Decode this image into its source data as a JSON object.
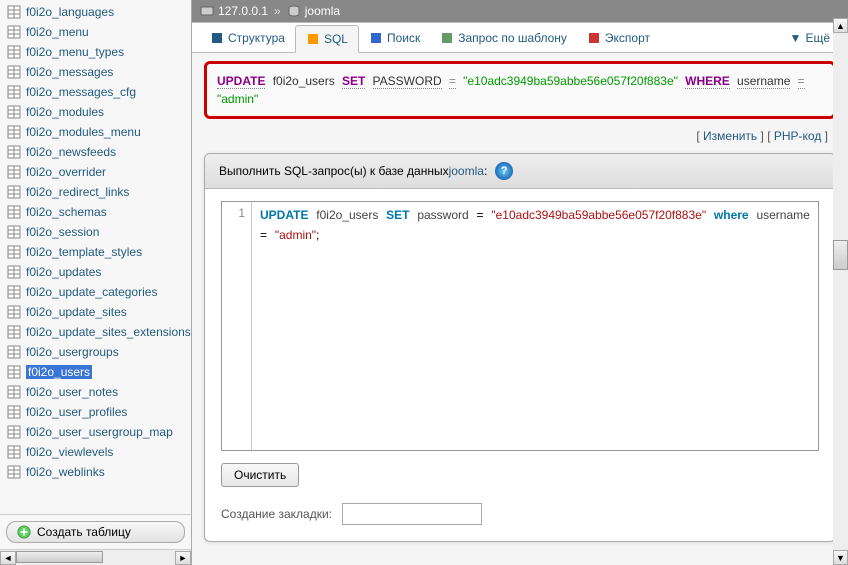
{
  "sidebar": {
    "tables": [
      "f0i2o_languages",
      "f0i2o_menu",
      "f0i2o_menu_types",
      "f0i2o_messages",
      "f0i2o_messages_cfg",
      "f0i2o_modules",
      "f0i2o_modules_menu",
      "f0i2o_newsfeeds",
      "f0i2o_overrider",
      "f0i2o_redirect_links",
      "f0i2o_schemas",
      "f0i2o_session",
      "f0i2o_template_styles",
      "f0i2o_updates",
      "f0i2o_update_categories",
      "f0i2o_update_sites",
      "f0i2o_update_sites_extensions",
      "f0i2o_usergroups",
      "f0i2o_users",
      "f0i2o_user_notes",
      "f0i2o_user_profiles",
      "f0i2o_user_usergroup_map",
      "f0i2o_viewlevels",
      "f0i2o_weblinks"
    ],
    "selected_index": 18,
    "create_label": "Создать таблицу"
  },
  "breadcrumb": {
    "host": "127.0.0.1",
    "db": "joomla"
  },
  "tabs": {
    "list": [
      "Структура",
      "SQL",
      "Поиск",
      "Запрос по шаблону",
      "Экспорт"
    ],
    "more": "Ещё",
    "active_index": 1
  },
  "executed_query": {
    "update": "UPDATE",
    "table": "f0i2o_users",
    "set": "SET",
    "field": "PASSWORD",
    "eq": "=",
    "value": "\"e10adc3949ba59abbe56e057f20f883e\"",
    "where": "WHERE",
    "cond_field": "username",
    "cond_eq": "=",
    "cond_value": "\"admin\""
  },
  "links": {
    "edit": "Изменить",
    "php": "PHP-код"
  },
  "panel": {
    "title_prefix": "Выполнить SQL-запрос(ы) к базе данных ",
    "db": "joomla",
    "suffix": ":"
  },
  "editor": {
    "line": "1",
    "sql_parts": {
      "update": "UPDATE",
      "table": "f0i2o_users",
      "set": "SET",
      "field": "password",
      "eq": "=",
      "value": "\"e10adc3949ba59abbe56e057f20f883e\"",
      "where": "where",
      "cond_field": "username",
      "cond_eq": "=",
      "cond_value": "\"admin\"",
      "term": ";"
    }
  },
  "controls": {
    "clear": "Очистить",
    "bookmark_label": "Создание закладки:"
  }
}
